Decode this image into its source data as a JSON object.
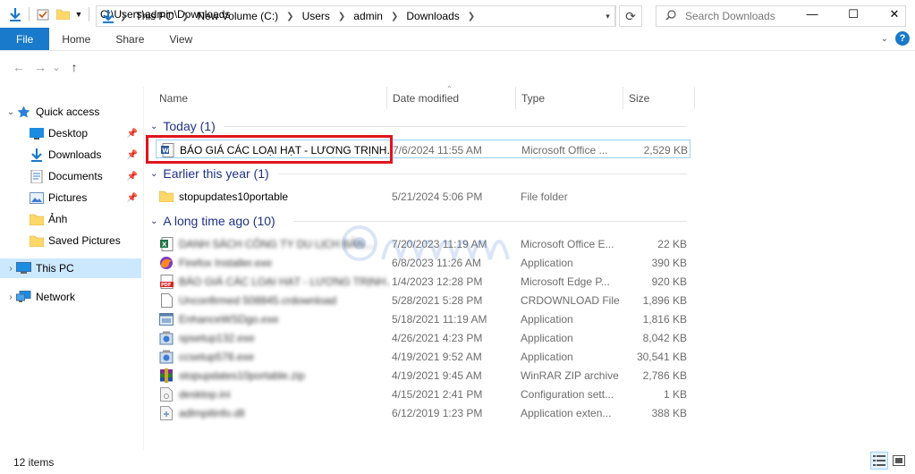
{
  "titlebar": {
    "path": "C:\\Users\\admin\\Downloads",
    "minimize": "—",
    "maximize": "☐",
    "close": "✕"
  },
  "ribbon": {
    "tabs": [
      "File",
      "Home",
      "Share",
      "View"
    ]
  },
  "nav": {
    "back": "←",
    "forward": "→",
    "recent": "⌄",
    "up": "↑",
    "breadcrumbs": [
      "This PC",
      "New Volume (C:)",
      "Users",
      "admin",
      "Downloads"
    ],
    "search_placeholder": "Search Downloads"
  },
  "navpane": {
    "items": [
      {
        "label": "Quick access",
        "icon": "star-icon"
      },
      {
        "label": "Desktop",
        "icon": "desktop-icon"
      },
      {
        "label": "Downloads",
        "icon": "download-icon"
      },
      {
        "label": "Documents",
        "icon": "documents-icon"
      },
      {
        "label": "Pictures",
        "icon": "pictures-icon"
      },
      {
        "label": "Ảnh",
        "icon": "folder-icon"
      },
      {
        "label": "Saved Pictures",
        "icon": "folder-icon"
      },
      {
        "label": "This PC",
        "icon": "computer-icon"
      },
      {
        "label": "Network",
        "icon": "network-icon"
      }
    ]
  },
  "columns": [
    "Name",
    "Date modified",
    "Type",
    "Size"
  ],
  "groups": [
    {
      "label": "Today (1)"
    },
    {
      "label": "Earlier this year (1)"
    },
    {
      "label": "A long time ago (10)"
    }
  ],
  "files": [
    {
      "name": "BÁO GIÁ CÁC LOẠI HẠT - LƯƠNG TRỊNH...",
      "date": "7/6/2024 11:55 AM",
      "type": "Microsoft Office ...",
      "size": "2,529 KB",
      "icon": "word-doc-icon"
    },
    {
      "name": "stopupdates10portable",
      "date": "5/21/2024 5:06 PM",
      "type": "File folder",
      "size": "",
      "icon": "folder-icon"
    },
    {
      "name": "DANH SÁCH CÔNG TY DU LỊCH BẢN...",
      "date": "7/20/2023 11:19 AM",
      "type": "Microsoft Office E...",
      "size": "22 KB",
      "icon": "excel-icon"
    },
    {
      "name": "Firefox Installer.exe",
      "date": "6/8/2023 11:26 AM",
      "type": "Application",
      "size": "390 KB",
      "icon": "firefox-icon"
    },
    {
      "name": "BÁO GIÁ CÁC LOẠI HẠT - LƯƠNG TRỊNH...",
      "date": "1/4/2023 12:28 PM",
      "type": "Microsoft Edge P...",
      "size": "920 KB",
      "icon": "pdf-icon"
    },
    {
      "name": "Unconfirmed 508845.crdownload",
      "date": "5/28/2021 5:28 PM",
      "type": "CRDOWNLOAD File",
      "size": "1,896 KB",
      "icon": "generic-file-icon"
    },
    {
      "name": "EnhanceWSDgo.exe",
      "date": "5/18/2021 11:19 AM",
      "type": "Application",
      "size": "1,816 KB",
      "icon": "app-icon"
    },
    {
      "name": "spsetup132.exe",
      "date": "4/26/2021 4:23 PM",
      "type": "Application",
      "size": "8,042 KB",
      "icon": "setup-icon"
    },
    {
      "name": "ccsetup578.exe",
      "date": "4/19/2021 9:52 AM",
      "type": "Application",
      "size": "30,541 KB",
      "icon": "setup-icon"
    },
    {
      "name": "stopupdates10portable.zip",
      "date": "4/19/2021 9:45 AM",
      "type": "WinRAR ZIP archive",
      "size": "2,786 KB",
      "icon": "winrar-icon"
    },
    {
      "name": "desktop.ini",
      "date": "4/15/2021 2:41 PM",
      "type": "Configuration sett...",
      "size": "1 KB",
      "icon": "ini-icon"
    },
    {
      "name": "adlmpitinfo.dll",
      "date": "6/12/2019 1:23 PM",
      "type": "Application exten...",
      "size": "388 KB",
      "icon": "dll-icon"
    }
  ],
  "status": {
    "count": "12 items"
  },
  "colors": {
    "accent": "#1979ca",
    "group_text": "#1e3287",
    "selection": "#cce8ff",
    "highlight_box": "#e0141e"
  }
}
